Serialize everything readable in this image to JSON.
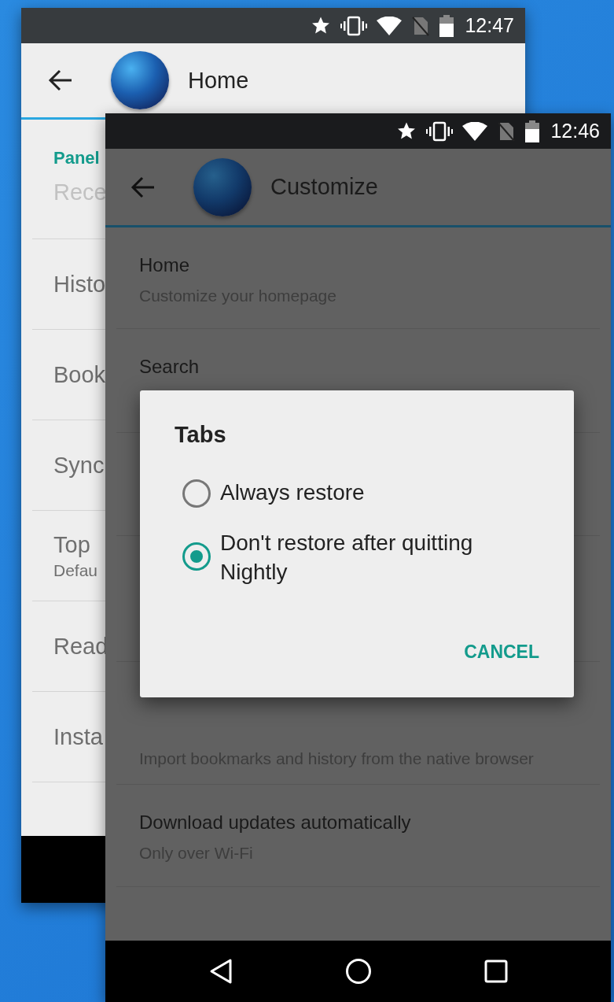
{
  "back_screen": {
    "status_bar": {
      "time": "12:47"
    },
    "app_bar": {
      "title": "Home"
    },
    "section_header": "Panel",
    "items": [
      {
        "title": "Rece",
        "disabled": true
      },
      {
        "title": "Histo",
        "disabled": false
      },
      {
        "title": "Book",
        "disabled": false
      },
      {
        "title": "Sync",
        "disabled": false
      },
      {
        "title": "Top",
        "subtitle": "Defau",
        "disabled": false
      },
      {
        "title": "Read",
        "disabled": false
      },
      {
        "title": "Insta",
        "disabled": false
      }
    ]
  },
  "front_screen": {
    "status_bar": {
      "time": "12:46"
    },
    "app_bar": {
      "title": "Customize"
    },
    "items": [
      {
        "title": "Home",
        "subtitle": "Customize your homepage"
      },
      {
        "title": "Search"
      },
      {
        "subtitle": "Import bookmarks and history from the native browser"
      },
      {
        "title": "Download updates automatically",
        "subtitle": "Only over Wi-Fi"
      }
    ]
  },
  "dialog": {
    "title": "Tabs",
    "options": [
      {
        "label": "Always restore",
        "selected": false
      },
      {
        "label": "Don't restore after quitting Nightly",
        "selected": true
      }
    ],
    "buttons": [
      "CANCEL"
    ]
  }
}
